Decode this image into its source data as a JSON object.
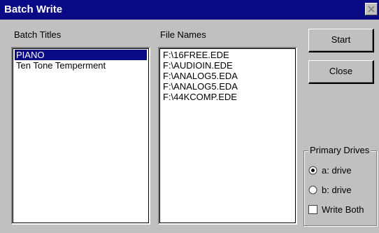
{
  "window": {
    "title": "Batch Write"
  },
  "batch_titles": {
    "label": "Batch Titles",
    "items": [
      {
        "label": "PIANO",
        "selected": true
      },
      {
        "label": "Ten Tone Temperment",
        "selected": false
      }
    ]
  },
  "file_names": {
    "label": "File Names",
    "items": [
      "F:\\16FREE.EDE",
      "F:\\AUDIOIN.EDE",
      "F:\\ANALOG5.EDA",
      "F:\\ANALOG5.EDA",
      "F:\\44KCOMP.EDE"
    ]
  },
  "buttons": {
    "start": "Start",
    "close": "Close"
  },
  "primary_drives": {
    "title": "Primary Drives",
    "a_drive": {
      "label": "a: drive",
      "checked": true
    },
    "b_drive": {
      "label": "b: drive",
      "checked": false
    },
    "write_both": {
      "label": "Write Both",
      "checked": false
    }
  },
  "colors": {
    "titlebar": "#0a0a86",
    "selection": "#0a0a86",
    "face": "#c0c0c0"
  },
  "icons": [
    "close-icon",
    "radio-selected-icon",
    "radio-empty-icon",
    "checkbox-empty-icon"
  ]
}
